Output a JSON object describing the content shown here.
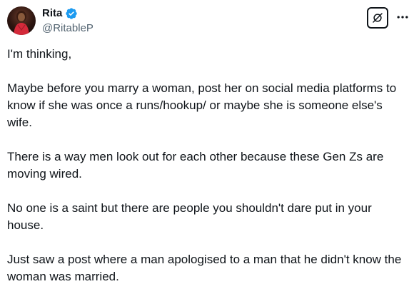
{
  "author": {
    "display_name": "Rita",
    "handle": "@RitableP",
    "verified": true,
    "avatar_icon": "profile-photo",
    "verified_color": "#1d9bf0"
  },
  "actions": {
    "grok_icon": "grok-icon",
    "more_icon": "more-horizontal-icon"
  },
  "tweet": {
    "paragraphs": [
      "I'm thinking,",
      "Maybe before you marry a woman, post her on social media platforms to know if she was once a runs/hookup/ or maybe she is someone else's wife.",
      "There is a way men look out for each other because these Gen Zs are moving wired.",
      "No one is a saint but there are people you shouldn't dare put in your house.",
      "Just saw a post where a man apologised to a man that he didn't know the woman was married."
    ]
  }
}
